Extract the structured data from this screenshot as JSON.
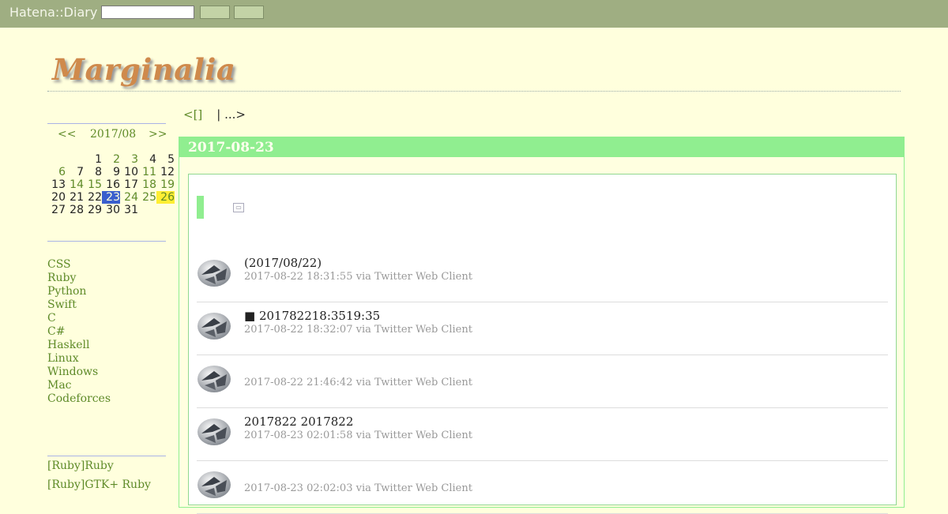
{
  "topbar": {
    "brand": "Hatena::Diary",
    "search_value": "",
    "button1_label": "",
    "button2_label": ""
  },
  "site": {
    "title": "Marginalia"
  },
  "calendar": {
    "prev": "<<",
    "month": "2017/08",
    "next": ">>",
    "weeks": [
      [
        "",
        "",
        "",
        "1",
        "2",
        "3",
        "4",
        "5"
      ],
      [
        "",
        "6",
        "7",
        "8",
        "9",
        "10",
        "11",
        "12"
      ],
      [
        "13",
        "14",
        "15",
        "16",
        "17",
        "18",
        "19"
      ],
      [
        "20",
        "21",
        "22",
        "23",
        "24",
        "25",
        "26"
      ],
      [
        "27",
        "28",
        "29",
        "30",
        "31"
      ]
    ],
    "linked_days": [
      "2",
      "3",
      "6",
      "11",
      "14",
      "15",
      "18",
      "19",
      "24",
      "25",
      "26"
    ],
    "today": "23",
    "highlight": "26"
  },
  "categories": [
    "CSS",
    "Ruby",
    "Python",
    "Swift",
    "C",
    "C#",
    "Haskell",
    "Linux",
    "Windows",
    "Mac",
    "Codeforces"
  ],
  "recent": [
    "[Ruby]Ruby",
    "[Ruby]GTK+ Ruby"
  ],
  "pager": {
    "prev": "<[]",
    "next": "| ...>"
  },
  "day": {
    "date": "2017-08-23"
  },
  "tweets": [
    {
      "text": "(2017/08/22)",
      "meta": "2017-08-22 18:31:55 via Twitter Web Client"
    },
    {
      "text": "■ 201782218:3519:35",
      "meta": "2017-08-22 18:32:07 via Twitter Web Client"
    },
    {
      "text": "",
      "meta": "2017-08-22 21:46:42 via Twitter Web Client"
    },
    {
      "text": "2017822  2017822",
      "meta": "2017-08-23 02:01:58 via Twitter Web Client"
    },
    {
      "text": "",
      "meta": "2017-08-23 02:02:03 via Twitter Web Client"
    }
  ]
}
